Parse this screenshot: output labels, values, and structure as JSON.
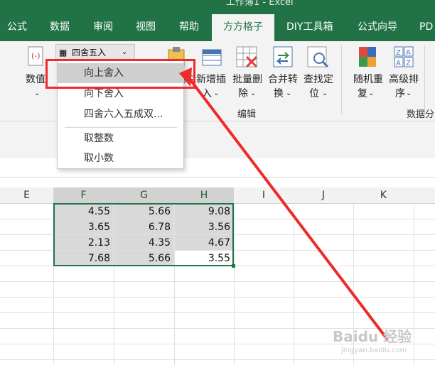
{
  "window_title": "工作簿1 - Excel",
  "tabs": [
    "公式",
    "数据",
    "审阅",
    "视图",
    "帮助",
    "方方格子",
    "DIY工具箱",
    "公式向导",
    "PD"
  ],
  "active_tab": "方方格子",
  "ribbon": {
    "dropdown_label": "四舍五入",
    "buttons": {
      "numeric": "数值",
      "b1": "新增插",
      "b1b": "入",
      "b2": "批量删",
      "b2b": "除",
      "b3": "合并转",
      "b3b": "换",
      "b4": "查找定",
      "b4b": "位",
      "b5": "随机重",
      "b5b": "复",
      "b6": "高级排",
      "b6b": "序"
    },
    "groups": {
      "edit": "编辑",
      "data_analysis": "数据分"
    }
  },
  "menu": {
    "items": [
      "向上舍入",
      "向下舍入",
      "四舍六入五成双...",
      "取整数",
      "取小数"
    ],
    "highlighted": "向上舍入"
  },
  "columns": [
    "E",
    "F",
    "G",
    "H",
    "I",
    "J",
    "K"
  ],
  "selected_columns": [
    "F",
    "G",
    "H"
  ],
  "cells": [
    [
      "4.55",
      "5.66",
      "9.08"
    ],
    [
      "3.65",
      "6.78",
      "3.56"
    ],
    [
      "2.13",
      "4.35",
      "4.67"
    ],
    [
      "7.68",
      "5.66",
      "3.55"
    ]
  ],
  "colors": {
    "excel_green": "#217346",
    "annotation_red": "#ee2a2a"
  },
  "watermark": "Baidu 经验",
  "watermark_sub": "jingyan.baidu.com"
}
